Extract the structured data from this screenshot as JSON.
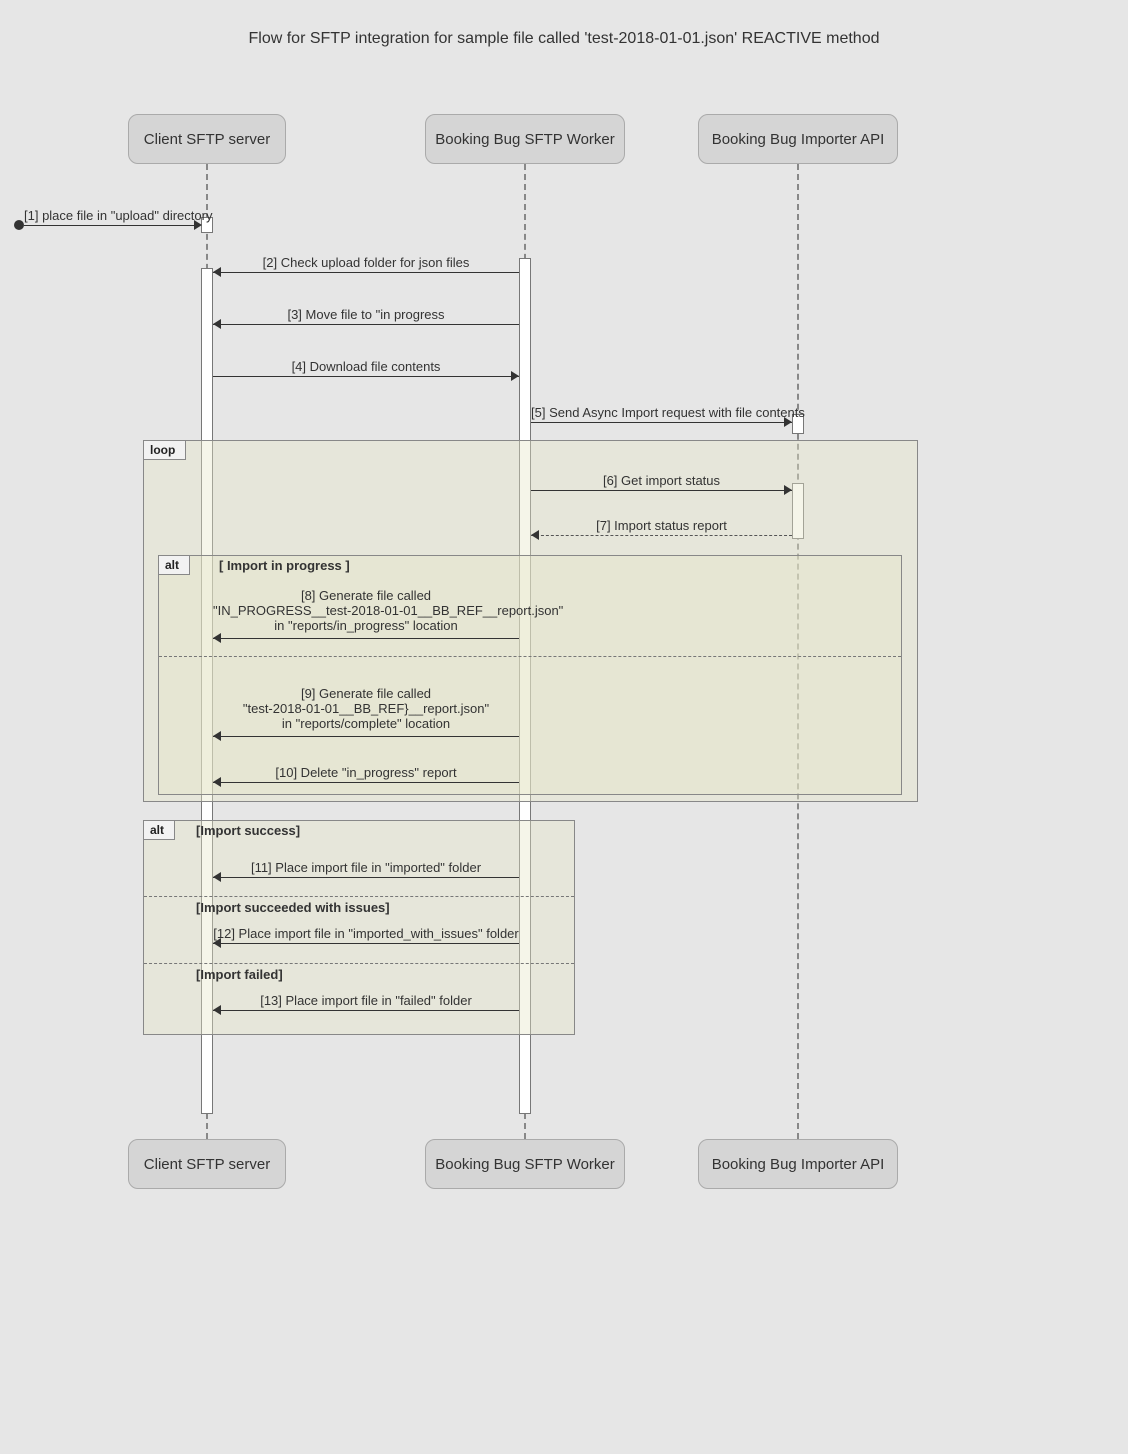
{
  "title": "Flow for SFTP integration for sample file called 'test-2018-01-01.json' REACTIVE method",
  "participants": {
    "client": "Client SFTP server",
    "worker": "Booking Bug SFTP Worker",
    "importer": "Booking Bug Importer API"
  },
  "fragments": {
    "loop": {
      "tag": "loop"
    },
    "alt1": {
      "tag": "alt",
      "cond_a": "[ Import in progress ]"
    },
    "alt2": {
      "tag": "alt",
      "cond_a": "[Import success]",
      "cond_b": "[Import succeeded with issues]",
      "cond_c": "[Import failed]"
    }
  },
  "messages": {
    "m1": "[1] place file in \"upload\" directory",
    "m2": "[2] Check upload folder for json files",
    "m3": "[3] Move file to \"in progress",
    "m4": "[4] Download file contents",
    "m5": "[5] Send Async Import request with file contents",
    "m6": "[6] Get import status",
    "m7": "[7] Import status report",
    "m8": "[8] Generate file called\n\"IN_PROGRESS__test-2018-01-01__BB_REF__report.json\"\nin \"reports/in_progress\" location",
    "m9": "[9] Generate file called\n\"test-2018-01-01__BB_REF}__report.json\"\nin \"reports/complete\" location",
    "m10": "[10] Delete \"in_progress\" report",
    "m11": "[11] Place import file in \"imported\" folder",
    "m12": "[12] Place import file in \"imported_with_issues\" folder",
    "m13": "[13] Place import file in \"failed\" folder"
  }
}
